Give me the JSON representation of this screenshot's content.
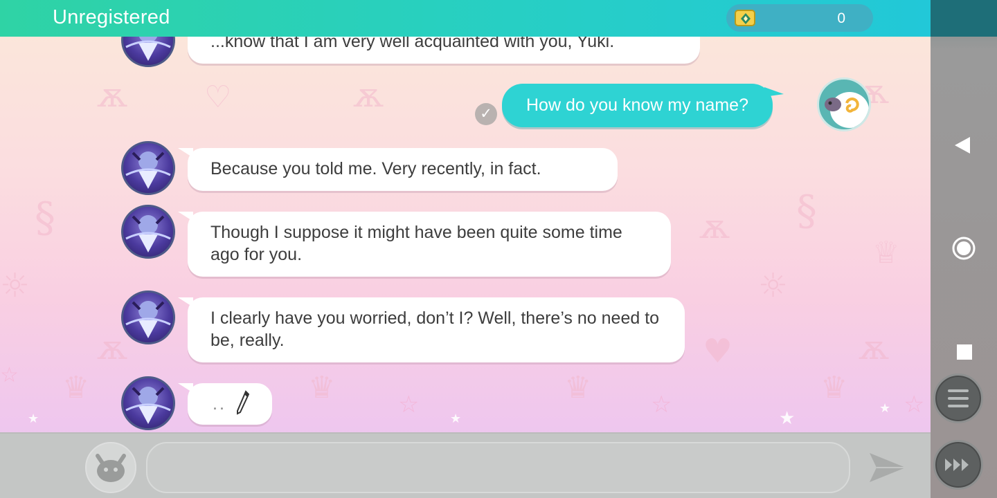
{
  "header": {
    "title": "Unregistered",
    "currency_value": "0",
    "currency_icon": "gem-ticket-icon"
  },
  "messages": [
    {
      "sender": "npc",
      "text": "...know that I am very well acquainted with you, Yuki."
    },
    {
      "sender": "user",
      "text": "How do you know my name?",
      "read": true
    },
    {
      "sender": "npc",
      "text": "Because you told me. Very recently, in fact."
    },
    {
      "sender": "npc",
      "text": "Though I suppose it might have been quite some time ago for you."
    },
    {
      "sender": "npc",
      "text": "I clearly have you worried, don’t I? Well, there’s no need to be, really."
    },
    {
      "sender": "npc",
      "text": "..",
      "typing": true
    }
  ],
  "input": {
    "value": "",
    "placeholder": ""
  },
  "colors": {
    "header": "#27cfc4",
    "user_bubble": "#2ed3d3",
    "npc_bubble": "#ffffff",
    "currency_pill": "#3fb0c4"
  },
  "navbar": {
    "icons": [
      "back-icon",
      "home-icon",
      "recents-icon",
      "menu-icon",
      "fast-forward-icon"
    ]
  }
}
